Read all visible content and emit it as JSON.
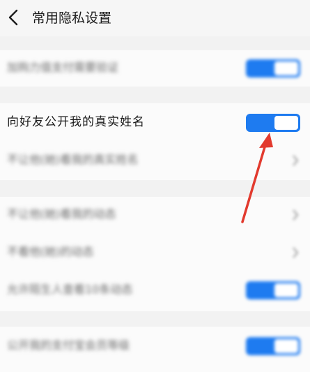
{
  "header": {
    "title": "常用隐私设置"
  },
  "rows": [
    {
      "label": "加购力值支付需要验证",
      "control": "toggle",
      "on": true
    },
    {
      "label": "向好友公开我的真实姓名",
      "control": "toggle",
      "on": true
    },
    {
      "label": "不让他(她)看我的真实姓名",
      "control": "chevron"
    },
    {
      "label": "不让他(她)看我的动态",
      "control": "chevron"
    },
    {
      "label": "不看他(她)的动态",
      "control": "chevron"
    },
    {
      "label": "允许陌生人查看10条动态",
      "control": "toggle",
      "on": true
    },
    {
      "label": "公开我的支付宝会员等级",
      "control": "toggle",
      "on": true
    }
  ],
  "colors": {
    "accent": "#1e7bf0",
    "annotation_arrow": "#e23a2e"
  }
}
